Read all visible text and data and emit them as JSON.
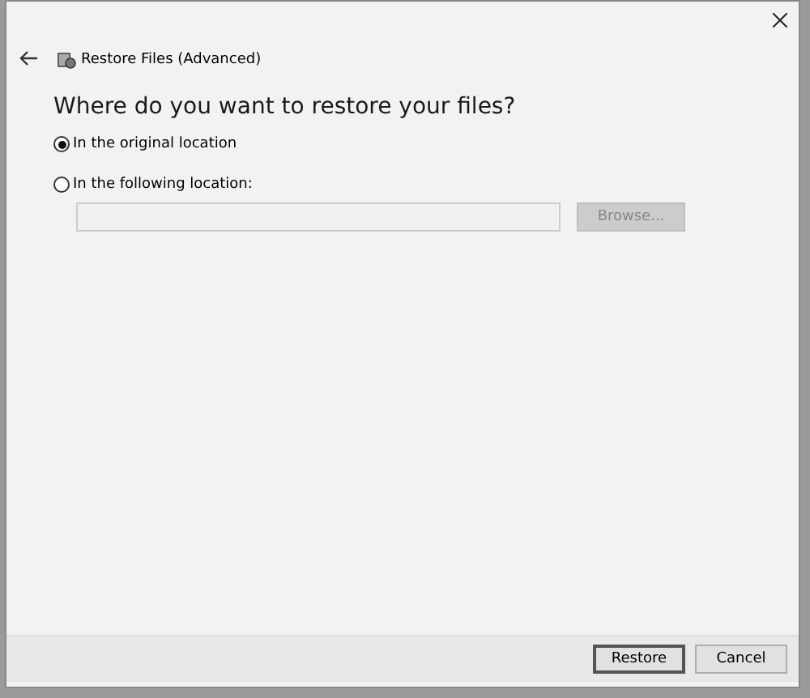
{
  "header": {
    "title": "Restore Files (Advanced)"
  },
  "question": "Where do you want to restore your files?",
  "options": [
    {
      "label": "In the original location",
      "selected": true
    },
    {
      "label": "In the following location:",
      "selected": false
    }
  ],
  "location": {
    "disabled": true,
    "browse": {
      "label": "Browse...",
      "disabled": true
    }
  },
  "buttons": [
    {
      "label": "Restore",
      "default": true
    },
    {
      "label": "Cancel",
      "default": false
    }
  ]
}
